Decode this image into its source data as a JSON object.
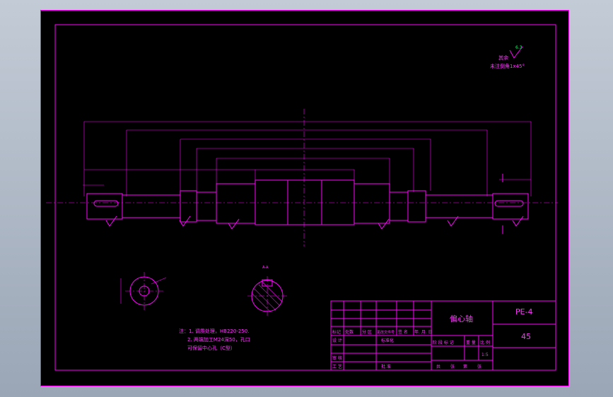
{
  "colors": {
    "line": "#ff00ff",
    "text": "#ff33ff",
    "surface_mark": "#00ff66",
    "background": "#000000"
  },
  "surface_note": {
    "top": "其余",
    "roughness": "6.3",
    "chamfer": "未注倒角1x45°"
  },
  "notes": {
    "line1": "注：1. 调质处理，HB220-250.",
    "line2": "2. 两端加工M24深50，孔口",
    "line3": "可保留中心孔（C型）"
  },
  "section": {
    "label": "A-A"
  },
  "title_block": {
    "part_name": "偏心轴",
    "drawing_no": "PE-4",
    "material": "45",
    "scale": "1:5",
    "headers": [
      "标记",
      "处数",
      "分 区",
      "更改文件号",
      "签 名",
      "年. 月. 日"
    ],
    "row_design": "设 计",
    "row_standard": "标准化",
    "stage_headers": [
      "阶 段 标 记",
      "重 量",
      "比 例"
    ],
    "row_check": "审 核",
    "row_process": "工 艺",
    "row_approve": "批 准",
    "sheets": [
      "共",
      "张",
      "第",
      "张"
    ]
  }
}
